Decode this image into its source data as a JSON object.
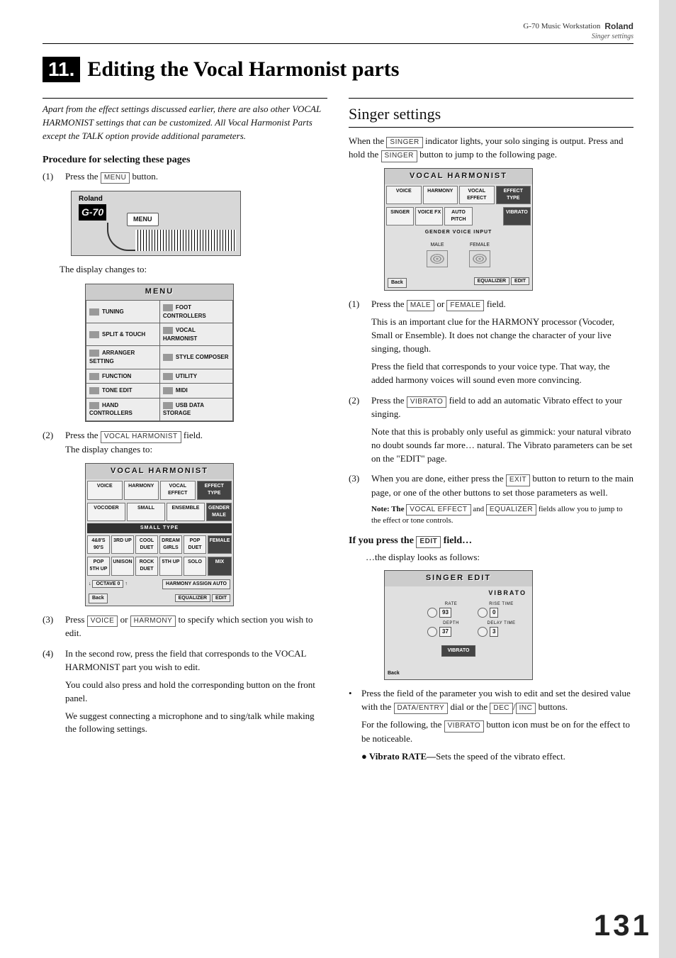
{
  "header": {
    "product": "G-70 Music Workstation",
    "brand": "Roland",
    "section": "Singer settings"
  },
  "chapter": {
    "number": "11.",
    "title": "Editing the Vocal Harmonist parts"
  },
  "left": {
    "intro": "Apart from the effect settings discussed earlier, there are also other VOCAL HARMONIST settings that can be customized. All Vocal Harmonist Parts except the TALK option provide additional parameters.",
    "subhead": "Procedure for selecting these pages",
    "step1_pre": "Press the ",
    "btn_menu": "MENU",
    "step1_post": " button.",
    "device_menu_label": "MENU",
    "device_brand": "G-70",
    "device_top": "Roland",
    "caption1": "The display changes to:",
    "fig_menu_title": "MENU",
    "fig_menu_rows": [
      [
        "TUNING",
        "FOOT CONTROLLERS"
      ],
      [
        "SPLIT & TOUCH",
        "VOCAL HARMONIST"
      ],
      [
        "ARRANGER SETTING",
        "STYLE COMPOSER"
      ],
      [
        "FUNCTION",
        "UTILITY"
      ],
      [
        "TONE EDIT",
        "MIDI"
      ],
      [
        "HAND CONTROLLERS",
        "USB DATA STORAGE"
      ]
    ],
    "step2_pre": "Press the ",
    "btn_vh": "VOCAL HARMONIST",
    "step2_post": " field.",
    "caption2": "The display changes to:",
    "fig_vh_title": "VOCAL HARMONIST",
    "fig_vh_tabs1": [
      "VOICE",
      "HARMONY",
      "VOCAL EFFECT",
      "EFFECT TYPE"
    ],
    "fig_vh_tabs2": [
      "VOCODER",
      "SMALL",
      "ENSEMBLE"
    ],
    "fig_vh_gender_label": "GENDER",
    "fig_vh_gender_val": "MALE",
    "fig_vh_smalltype": "SMALL TYPE",
    "fig_vh_row1": [
      "4&8'S 90'S",
      "3RD UP",
      "COOL DUET",
      "DREAM GIRLS",
      "POP DUET"
    ],
    "fig_vh_row1_end": "FEMALE",
    "fig_vh_row2": [
      "POP 5TH UP",
      "UNISON",
      "ROCK DUET",
      "5TH UP",
      "SOLO"
    ],
    "fig_vh_row2_end": "MIX",
    "fig_vh_octave": "OCTAVE 0",
    "fig_vh_assign": "HARMONY ASSIGN AUTO",
    "fig_vh_back": "Back",
    "fig_vh_eq": "EQUALIZER",
    "fig_vh_edit": "EDIT",
    "step3_pre": "Press ",
    "btn_voice": "VOICE",
    "step3_or": " or ",
    "btn_harmony": "HARMONY",
    "step3_post": " to specify which section you wish to edit.",
    "step4_a": "In the second row, press the field that corresponds to the VOCAL HARMONIST part you wish to edit.",
    "step4_b": "You could also press and hold the corresponding button on the front panel.",
    "step4_c": "We suggest connecting a microphone and to sing/talk while making the following settings."
  },
  "right": {
    "section_title": "Singer settings",
    "para1_a": "When the ",
    "btn_singer1": "SINGER",
    "para1_b": " indicator lights, your solo singing is output. Press and hold the ",
    "btn_singer2": "SINGER",
    "para1_c": " button to jump to the following page.",
    "fig_singer_title": "VOCAL HARMONIST",
    "fig_singer_tabs1": [
      "VOICE",
      "HARMONY",
      "VOCAL EFFECT",
      "EFFECT TYPE"
    ],
    "fig_singer_tabs2": [
      "SINGER",
      "VOICE FX",
      "AUTO PITCH",
      "",
      "VIBRATO"
    ],
    "fig_singer_gvi": "GENDER VOICE INPUT",
    "fig_singer_male": "MALE",
    "fig_singer_female": "FEMALE",
    "fig_singer_back": "Back",
    "fig_singer_eq": "EQUALIZER",
    "fig_singer_edit": "EDIT",
    "step1_pre": "Press the ",
    "btn_male": "MALE",
    "step1_or": " or ",
    "btn_female": "FEMALE",
    "step1_post": " field.",
    "step1_b": "This is an important clue for the HARMONY processor (Vocoder, Small or Ensemble). It does not change the character of your live singing, though.",
    "step1_c": "Press the field that corresponds to your voice type. That way, the added harmony voices will sound even more convincing.",
    "step2_pre": "Press the ",
    "btn_vibrato": "VIBRATO",
    "step2_post": " field to add an automatic Vibrato effect to your singing.",
    "step2_b": "Note that this is probably only useful as gimmick: your natural vibrato no doubt sounds far more… natural. The Vibrato parameters can be set on the \"EDIT\" page.",
    "step3_pre": "When you are done, either press the ",
    "btn_exit": "EXIT",
    "step3_post": " button to return to the main page, or one of the other buttons to set those parameters as well.",
    "note_pre": "Note: The ",
    "btn_voceff": "VOCAL EFFECT",
    "note_mid": " and ",
    "btn_eq": "EQUALIZER",
    "note_post": " fields allow you to jump to the effect or tone controls.",
    "edit_head_pre": "If you press the ",
    "btn_edit": "EDIT",
    "edit_head_post": " field…",
    "edit_caption": "…the display looks as follows:",
    "fig_edit_title": "SINGER EDIT",
    "fig_edit_vibrato": "VIBRATO",
    "fig_edit_labels": [
      "RATE",
      "RISE TIME",
      "DEPTH",
      "DELAY TIME"
    ],
    "fig_edit_vals": [
      "93",
      "0",
      "37",
      "3"
    ],
    "fig_edit_btn": "VIBRATO",
    "fig_edit_back": "Back",
    "bullet1_a": "Press the field of the parameter you wish to edit and set the desired value with the ",
    "btn_dataentry": "DATA/ENTRY",
    "bullet1_b": " dial or the ",
    "btn_dec": "DEC",
    "bullet1_slash": "/",
    "btn_inc": "INC",
    "bullet1_c": " buttons.",
    "bullet1_d_a": "For the following, the ",
    "btn_vib2": "VIBRATO",
    "bullet1_d_b": " button icon must be on for the effect to be noticeable.",
    "subbullet_label": "● Vibrato RATE—",
    "subbullet_text": "Sets the speed of the vibrato effect."
  },
  "page_number": "131"
}
